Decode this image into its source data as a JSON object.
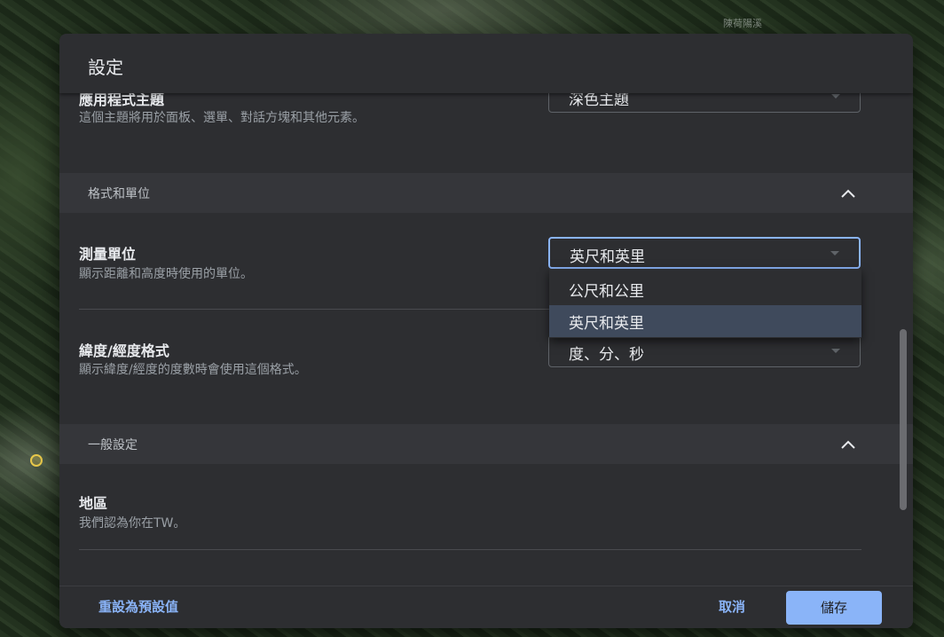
{
  "map": {
    "place_label": "陳荷陽溪"
  },
  "dialog": {
    "title": "設定",
    "app_theme": {
      "title": "應用程式主題",
      "description": "這個主題將用於面板、選單、對話方塊和其他元素。",
      "value": "深色主題"
    },
    "format_section": {
      "title": "格式和單位",
      "measurement": {
        "title": "測量單位",
        "description": "顯示距離和高度時使用的單位。",
        "value": "英尺和英里",
        "options": [
          "公尺和公里",
          "英尺和英里"
        ]
      },
      "latlng": {
        "title": "緯度/經度格式",
        "description": "顯示緯度/經度的度數時會使用這個格式。",
        "value": "度、分、秒"
      }
    },
    "general_section": {
      "title": "一般設定",
      "region": {
        "title": "地區",
        "description": "我們認為你在TW。"
      }
    },
    "footer": {
      "reset_label": "重設為預設值",
      "cancel_label": "取消",
      "save_label": "儲存"
    }
  },
  "colors": {
    "accent": "#8ab4f8",
    "dialog_bg": "#2d2e31",
    "section_bg": "#35363a",
    "selected_option_bg": "#3f4a5c"
  }
}
